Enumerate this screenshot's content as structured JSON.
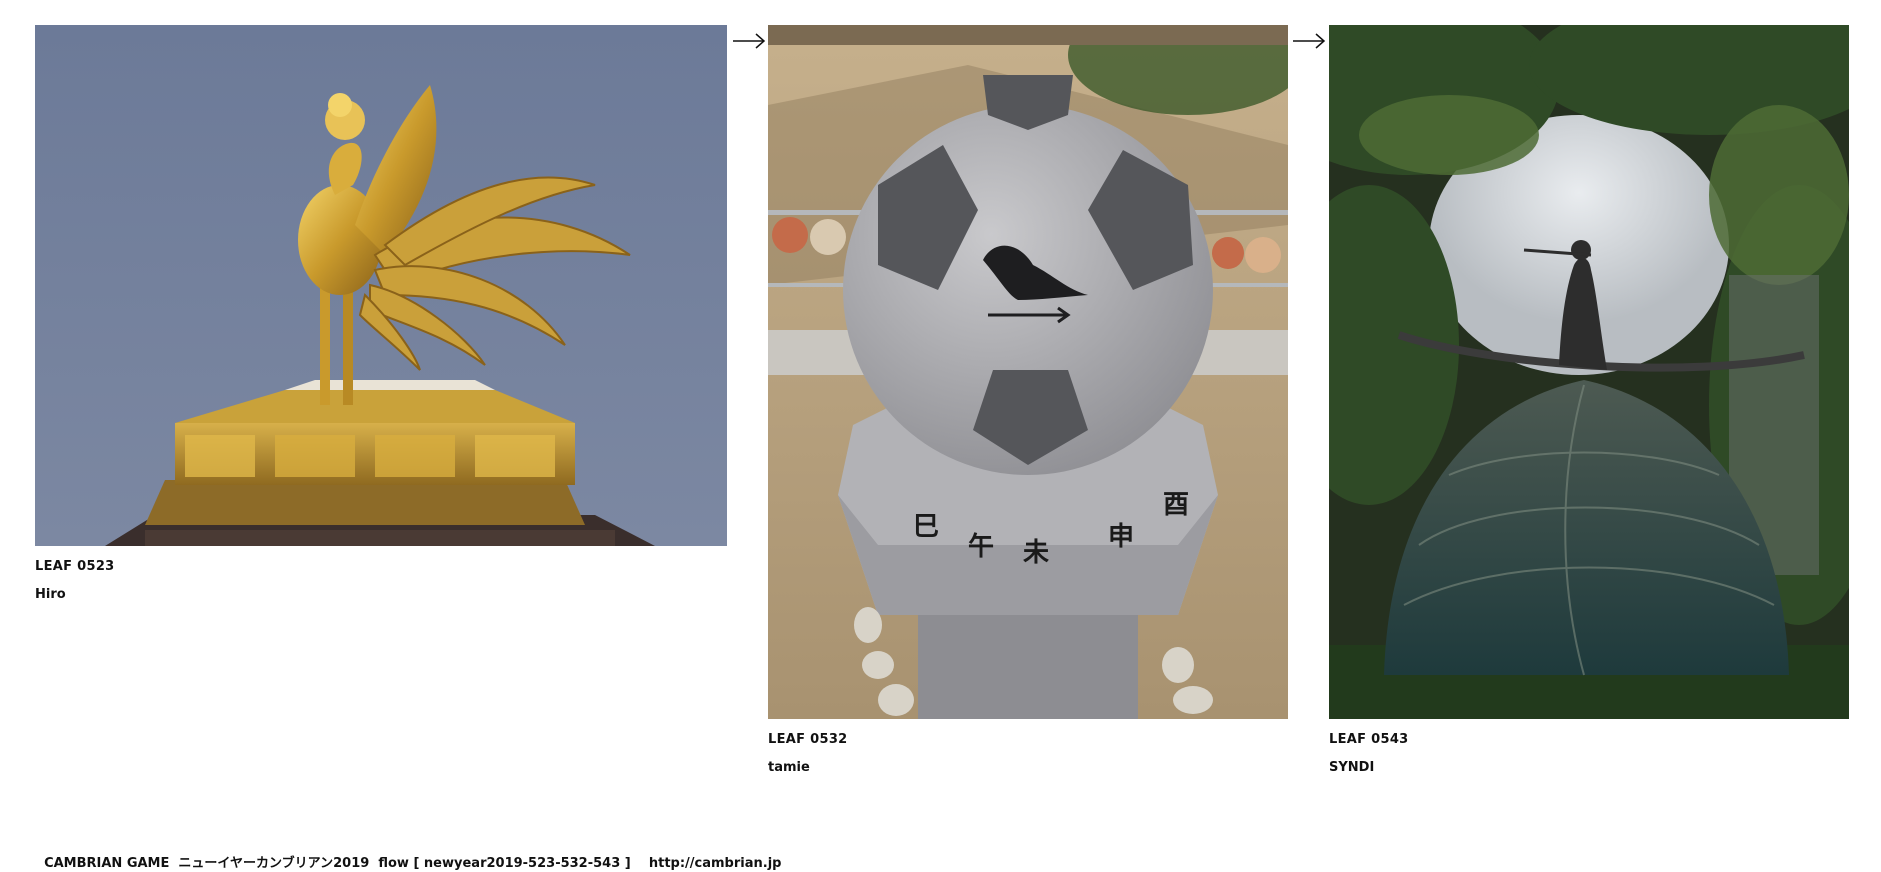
{
  "leaves": [
    {
      "id_label": "LEAF 0523",
      "author": "Hiro",
      "photo_subject": "golden-phoenix-statue"
    },
    {
      "id_label": "LEAF 0532",
      "author": "tamie",
      "photo_subject": "stone-soccer-ball-monument",
      "inscription": "巳午未申酉"
    },
    {
      "id_label": "LEAF 0543",
      "author": "SYNDI",
      "photo_subject": "flute-player-statue-in-park"
    }
  ],
  "arrows": [
    "right-arrow-icon",
    "right-arrow-icon"
  ],
  "footer": {
    "game_title": "CAMBRIAN GAME  ニューイヤーカンブリアン2019  flow [ newyear2019-523-532-543 ]",
    "url": "http://cambrian.jp"
  },
  "colors": {
    "text": "#111111",
    "background": "#ffffff",
    "sky": "#6f7c99",
    "gold": "#c9a23a",
    "granite": "#a9a9ad",
    "foliage": "#2c3a24"
  }
}
